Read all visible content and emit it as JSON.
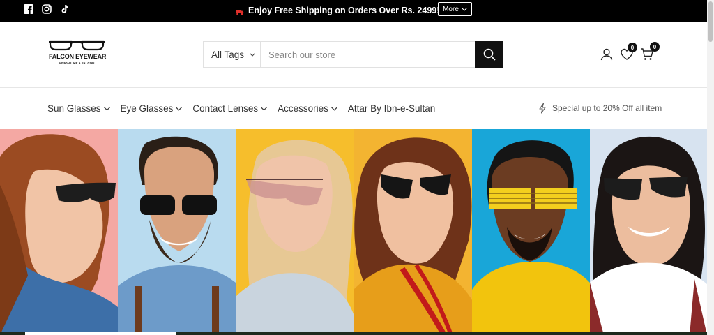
{
  "topbar": {
    "announcement": "Enjoy Free Shipping on Orders Over Rs. 2499!",
    "more_label": "More",
    "social": [
      "facebook-icon",
      "instagram-icon",
      "tiktok-icon"
    ]
  },
  "header": {
    "logo": {
      "brand": "FALCON EYEWEAR",
      "tagline": "VISION LIKE A FALCON"
    },
    "search": {
      "category": "All Tags",
      "placeholder": "Search our store"
    },
    "wishlist_count": "0",
    "cart_count": "0"
  },
  "nav": {
    "items": [
      {
        "label": "Sun Glasses",
        "dropdown": true
      },
      {
        "label": "Eye Glasses",
        "dropdown": true
      },
      {
        "label": "Contact Lenses",
        "dropdown": true
      },
      {
        "label": "Accessories",
        "dropdown": true
      },
      {
        "label": "Attar By Ibn-e-Sultan",
        "dropdown": false
      }
    ],
    "promo": "Special up to 20% Off all item"
  },
  "hero": {
    "panels": [
      {
        "bg": "#f4a8a3"
      },
      {
        "bg": "#b9dbef"
      },
      {
        "bg": "#f6be2c"
      },
      {
        "bg": "#f3b431"
      },
      {
        "bg": "#19a6d8"
      },
      {
        "bg": "#d7e3f0"
      }
    ]
  },
  "colors": {
    "topbar": "#000000",
    "accent": "#111111"
  }
}
